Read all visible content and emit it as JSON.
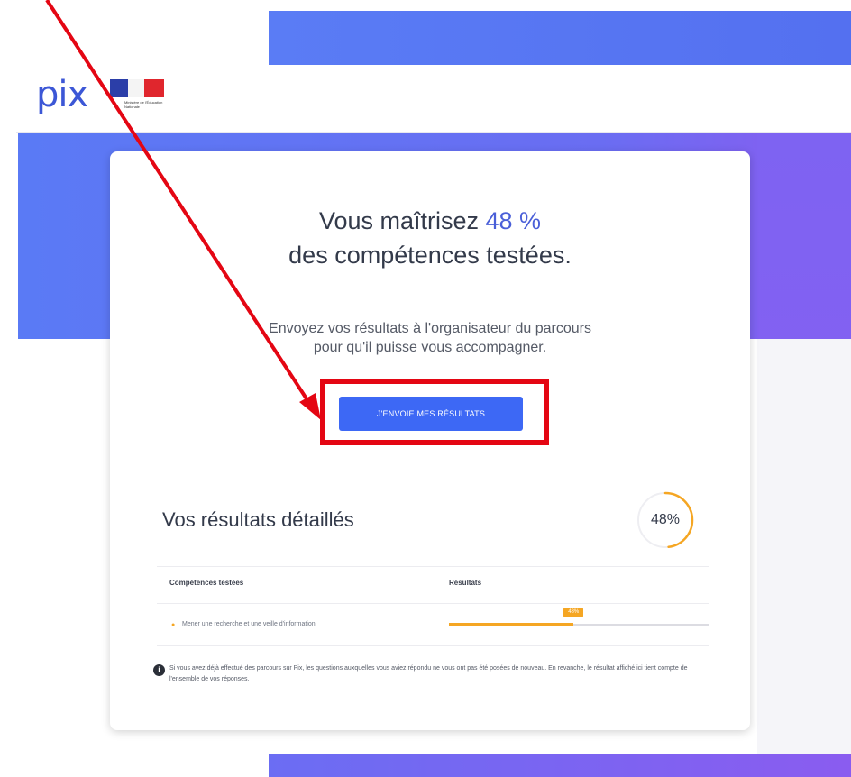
{
  "header": {
    "logo_text": "pix",
    "ministry_logo_text": "Ministère de l'Éducation Nationale"
  },
  "score": {
    "line1_prefix": "Vous maîtrisez ",
    "percentage": "48 %",
    "line2": "des compétences testées."
  },
  "send": {
    "message_line1": "Envoyez vos résultats à l'organisateur du parcours",
    "message_line2": "pour qu'il puisse vous accompagner.",
    "button_label": "J'ENVOIE MES RÉSULTATS"
  },
  "details": {
    "title": "Vos résultats détaillés",
    "overall_percent": "48%",
    "overall_value": 0.48,
    "table": {
      "headers": [
        "Compétences testées",
        "Résultats"
      ],
      "rows": [
        {
          "competence": "Mener une recherche et une veille d'information",
          "result_label": "48%",
          "result_value": 0.48
        }
      ]
    },
    "info_text": "Si vous avez déjà effectué des parcours sur Pix, les questions auxquelles vous aviez répondu ne vous ont pas été posées de nouveau. En revanche, le résultat affiché ici tient compte de l'ensemble de vos réponses."
  },
  "colors": {
    "brand_blue": "#3d68f5",
    "highlight_red": "#e40613",
    "progress_orange": "#f5a623",
    "background_gradient": [
      "#5a7af5",
      "#8a5cf0"
    ]
  },
  "icons": [
    "info-icon",
    "annotation-arrow-icon"
  ]
}
